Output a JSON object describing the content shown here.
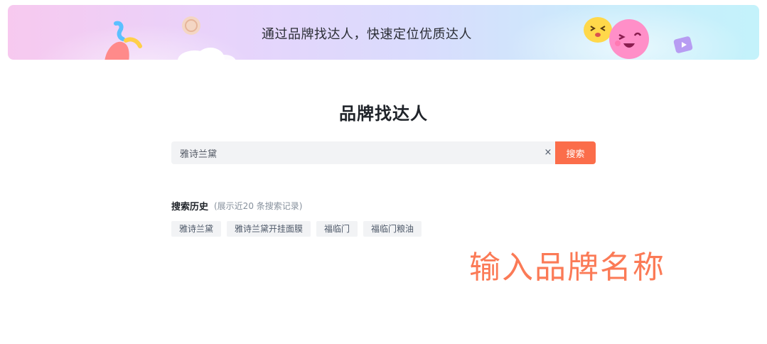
{
  "banner": {
    "title": "通过品牌找达人，快速定位优质达人"
  },
  "page": {
    "title": "品牌找达人"
  },
  "search": {
    "value": "雅诗兰黛",
    "clear_icon": "×",
    "button_label": "搜索"
  },
  "history": {
    "title": "搜索历史",
    "note": "(展示近20 条搜索记录)",
    "tags": [
      "雅诗兰黛",
      "雅诗兰黛开挂面膜",
      "福临门",
      "福临门粮油"
    ]
  },
  "annotation": {
    "text": "输入品牌名称"
  },
  "colors": {
    "accent": "#fb6d4a",
    "annotation": "#fb7a56",
    "input_bg": "#f2f3f5"
  }
}
